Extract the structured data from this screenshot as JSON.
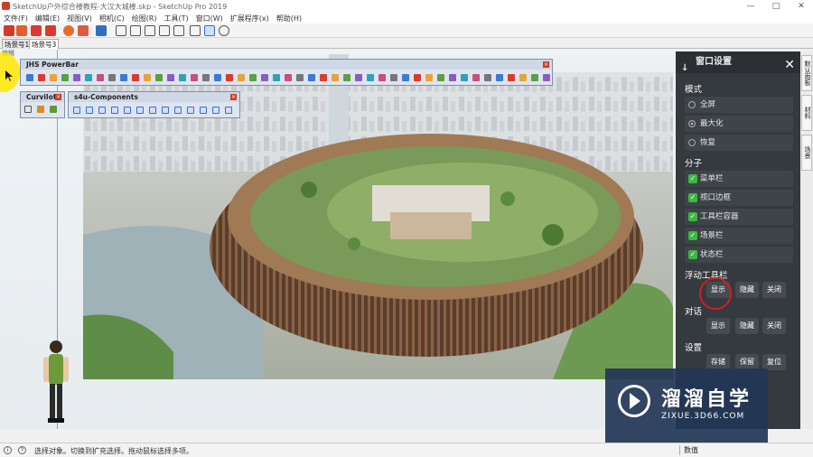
{
  "window": {
    "title": "SketchUp户外综合楼教程-大汉大城楼.skp - SketchUp Pro 2019",
    "minimize": "—",
    "maximize": "□",
    "close": "✕"
  },
  "menu": [
    "文件(F)",
    "编辑(E)",
    "视图(V)",
    "相机(C)",
    "绘图(R)",
    "工具(T)",
    "窗口(W)",
    "扩展程序(x)",
    "帮助(H)"
  ],
  "scene_tabs": [
    "场景号1",
    "场景号3"
  ],
  "viewport_label": "编辑",
  "powerbar": {
    "title": "JHS PowerBar"
  },
  "curviloft": {
    "title": "Curviloft"
  },
  "s4u": {
    "title": "s4u-Components"
  },
  "panel": {
    "title": "窗口设置",
    "close": "✕",
    "mode_heading": "模式",
    "modes": [
      {
        "label": "全屏",
        "selected": false
      },
      {
        "label": "最大化",
        "selected": true
      },
      {
        "label": "恢复",
        "selected": false
      }
    ],
    "children_heading": "分子",
    "children": [
      "菜单栏",
      "视口边框",
      "工具栏容器",
      "场景栏",
      "状态栏"
    ],
    "float_heading": "浮动工具栏",
    "float_buttons": [
      "显示",
      "隐藏",
      "关闭"
    ],
    "dialog_heading": "对话",
    "dialog_buttons": [
      "显示",
      "隐藏",
      "关闭"
    ],
    "settings_heading": "设置",
    "settings_buttons": [
      "存储",
      "保留",
      "复位"
    ]
  },
  "side_tabs": [
    "默认面板",
    "材料",
    "场景"
  ],
  "watermark": {
    "line1": "溜溜自学",
    "line2": "ZIXUE.3D66.COM"
  },
  "status": {
    "text": "选择对象。切换到扩充选择。拖动鼠标选择多项。",
    "measure_label": "数值"
  },
  "colors": {
    "panel_bg": "#353a3f",
    "check_green": "#3cb843",
    "accent_red": "#d23b2a"
  }
}
